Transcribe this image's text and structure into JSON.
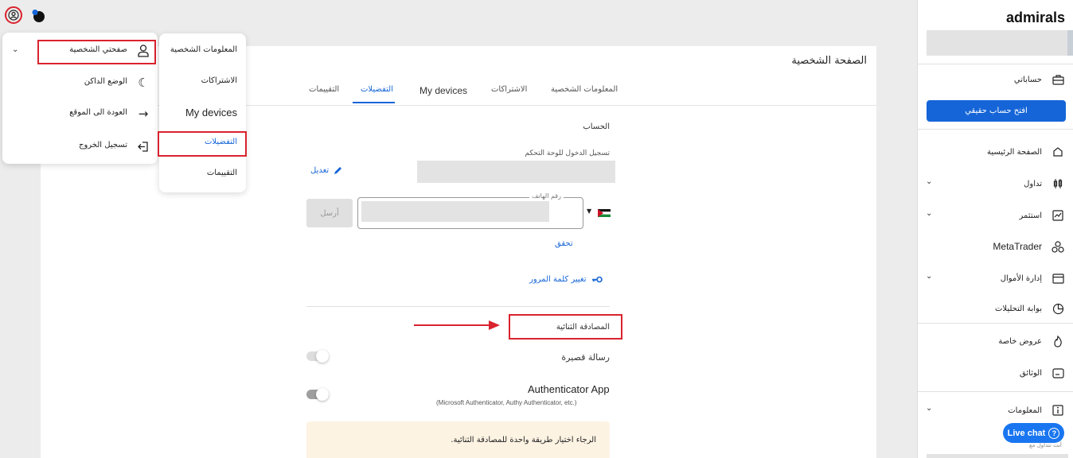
{
  "app": {
    "brand": "admirals"
  },
  "sidebar": {
    "accounts": {
      "label": "حساباتي",
      "icon": "briefcase-icon"
    },
    "open_real_account": "افتح حساب حقيقي",
    "items": [
      {
        "label": "الصفحة الرئيسية",
        "icon": "home-icon",
        "expandable": false
      },
      {
        "label": "تداول",
        "icon": "candlestick-icon",
        "expandable": true
      },
      {
        "label": "استثمر",
        "icon": "chart-icon",
        "expandable": true
      },
      {
        "label": "MetaTrader",
        "icon": "metatrader-icon",
        "expandable": false
      },
      {
        "label": "إدارة الأموال",
        "icon": "wallet-icon",
        "expandable": true
      },
      {
        "label": "بوابة التحليلات",
        "icon": "analytics-icon",
        "expandable": false
      },
      {
        "label": "عروض خاصة",
        "icon": "flame-icon",
        "expandable": false
      },
      {
        "label": "الوثائق",
        "icon": "documents-icon",
        "expandable": false
      },
      {
        "label": "المعلومات",
        "icon": "info-icon",
        "expandable": true
      }
    ],
    "live_chat": "Live chat",
    "footer_text": "أنت تتداول مع"
  },
  "main": {
    "page_title": "الصفحة الشخصية",
    "tabs": [
      {
        "label": "المعلومات الشخصية",
        "active": false
      },
      {
        "label": "الاشتراكات",
        "active": false
      },
      {
        "label": "My devices",
        "active": false
      },
      {
        "label": "التفضيلات",
        "active": true
      },
      {
        "label": "التقييمات",
        "active": false
      }
    ],
    "account_section": "الحساب",
    "login_label": "تسجيل الدخول للوحة التحكم",
    "edit_link": "تعديل",
    "phone_label": "رقم الهاتف",
    "send_button": "أرسل",
    "verify_link": "تحقق",
    "change_password": "تغيير كلمة المرور",
    "two_factor_title": "المصادقة الثنائية",
    "sms_label": "رسالة قصيرة",
    "authenticator_title": "Authenticator App",
    "authenticator_sub": "(Microsoft Authenticator, Authy Authenticator, etc.)",
    "notice": "الرجاء اختيار طريقة واحدة للمصادقة الثنائية."
  },
  "profile_menu": {
    "items": [
      {
        "label": "صفحتي الشخصية",
        "icon": "user-icon"
      },
      {
        "label": "الوضع الداكن",
        "icon": "moon-icon"
      },
      {
        "label": "العودة الى الموقع",
        "icon": "arrow-right-icon"
      },
      {
        "label": "تسجيل الخروج",
        "icon": "logout-icon"
      }
    ]
  },
  "sub_menu": {
    "items": [
      {
        "label": "المعلومات الشخصية"
      },
      {
        "label": "الاشتراكات"
      },
      {
        "label": "My devices"
      },
      {
        "label": "التفضيلات"
      },
      {
        "label": "التقييمات"
      }
    ]
  },
  "colors": {
    "accent": "#1565d8",
    "highlight": "#d9232e"
  }
}
